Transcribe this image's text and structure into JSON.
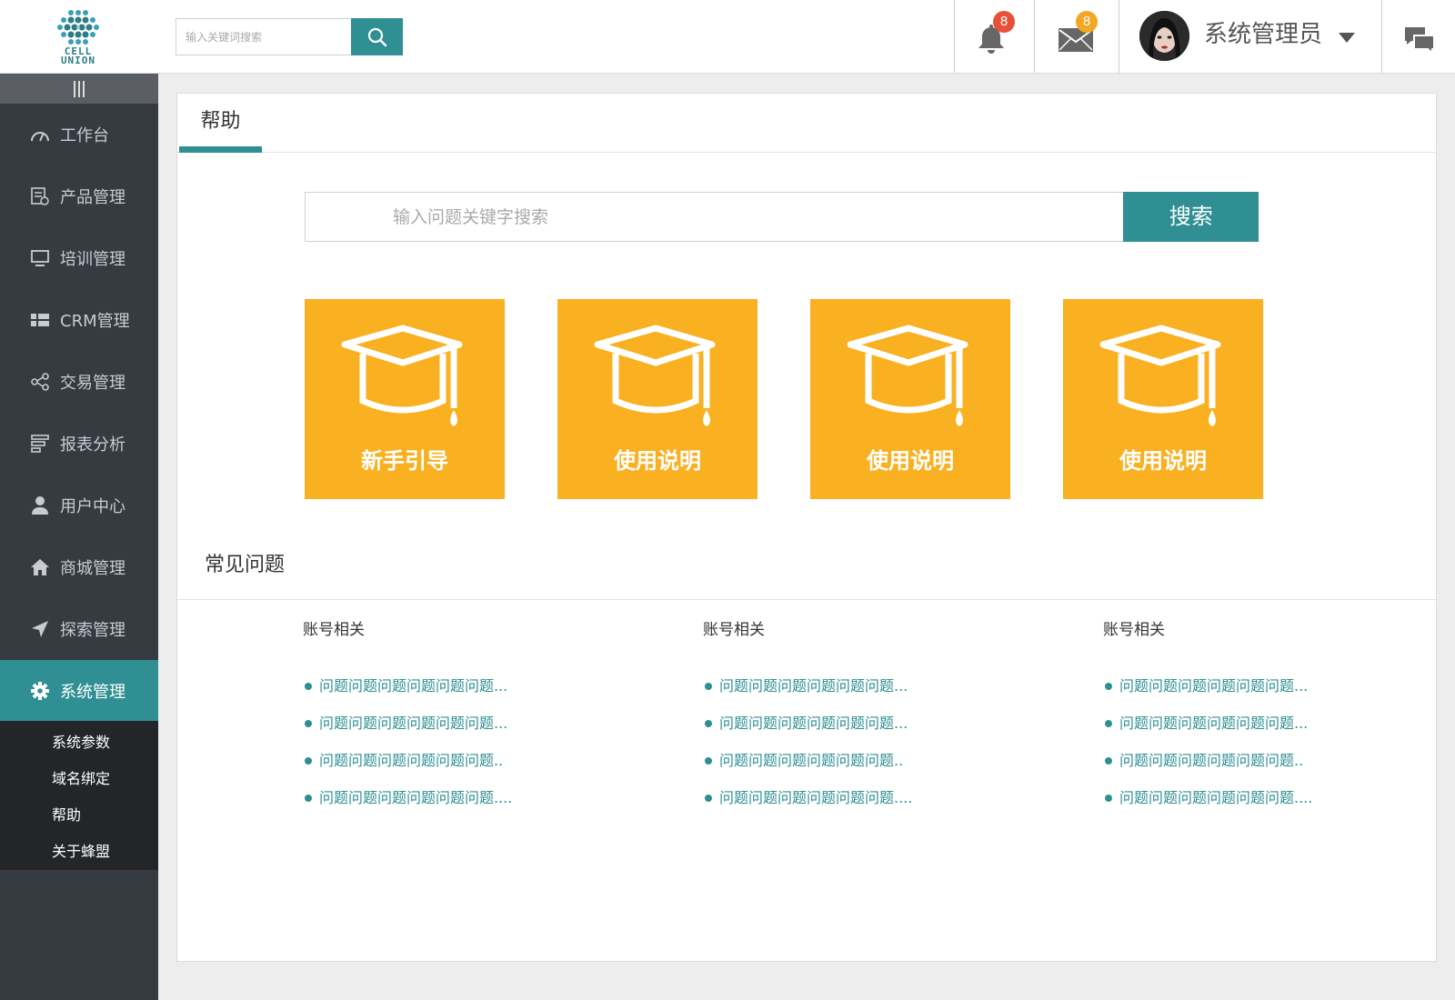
{
  "header": {
    "logo_text_line1": "CELL",
    "logo_text_line2": "UNION",
    "search_placeholder": "输入关键词搜索",
    "notifications_count": "8",
    "messages_count": "8",
    "username": "系统管理员"
  },
  "colors": {
    "accent": "#2f8f92",
    "card": "#f9b021",
    "sidebar": "#363a41",
    "badge_red": "#e8503a",
    "badge_orange": "#f5a623"
  },
  "sidebar": {
    "items": [
      {
        "label": "工作台",
        "icon": "dashboard-gauge-icon"
      },
      {
        "label": "产品管理",
        "icon": "product-list-icon"
      },
      {
        "label": "培训管理",
        "icon": "monitor-icon"
      },
      {
        "label": "CRM管理",
        "icon": "grid-list-icon"
      },
      {
        "label": "交易管理",
        "icon": "share-nodes-icon"
      },
      {
        "label": "报表分析",
        "icon": "report-bars-icon"
      },
      {
        "label": "用户中心",
        "icon": "user-icon"
      },
      {
        "label": "商城管理",
        "icon": "home-icon"
      },
      {
        "label": "探索管理",
        "icon": "paper-plane-icon"
      },
      {
        "label": "系统管理",
        "icon": "gear-icon"
      }
    ],
    "subitems": [
      "系统参数",
      "域名绑定",
      "帮助",
      "关于蜂盟"
    ]
  },
  "main": {
    "tab_label": "帮助",
    "question_search_placeholder": "输入问题关键字搜索",
    "search_button": "搜索",
    "cards": [
      {
        "label": "新手引导",
        "icon": "graduation-cap-icon"
      },
      {
        "label": "使用说明",
        "icon": "graduation-cap-icon"
      },
      {
        "label": "使用说明",
        "icon": "graduation-cap-icon"
      },
      {
        "label": "使用说明",
        "icon": "graduation-cap-icon"
      }
    ],
    "faq_title": "常见问题",
    "faq_columns": [
      {
        "title": "账号相关",
        "items": [
          "问题问题问题问题问题问题...",
          "问题问题问题问题问题问题...",
          "问题问题问题问题问题问题..",
          "问题问题问题问题问题问题...."
        ]
      },
      {
        "title": "账号相关",
        "items": [
          "问题问题问题问题问题问题...",
          "问题问题问题问题问题问题...",
          "问题问题问题问题问题问题..",
          "问题问题问题问题问题问题...."
        ]
      },
      {
        "title": "账号相关",
        "items": [
          "问题问题问题问题问题问题...",
          "问题问题问题问题问题问题...",
          "问题问题问题问题问题问题..",
          "问题问题问题问题问题问题...."
        ]
      }
    ]
  }
}
